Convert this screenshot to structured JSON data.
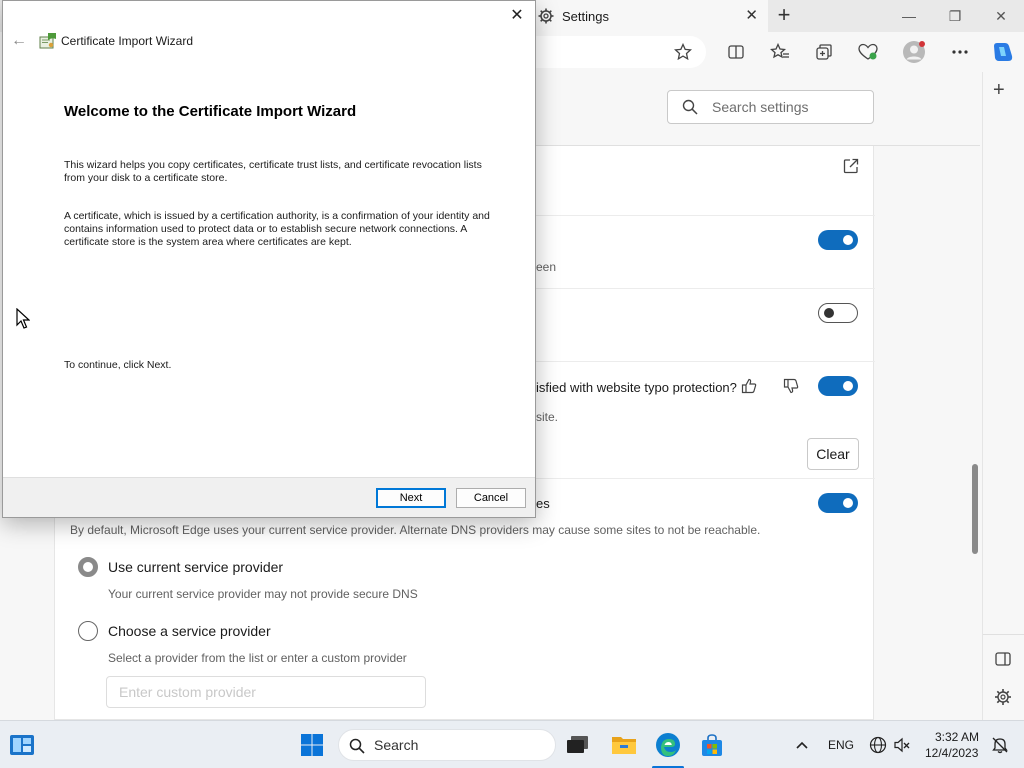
{
  "browser": {
    "tab_title": "Settings",
    "tab_close": "✕",
    "new_tab": "+",
    "window_controls": {
      "minimize": "—",
      "restore": "❐",
      "close": "✕"
    }
  },
  "settings": {
    "search_placeholder": "Search settings",
    "frag_screen": "een",
    "frag_typo_question": "isfied with website typo protection?",
    "frag_site": "site.",
    "clear_label": "Clear",
    "frag_es": "es",
    "dns_desc": "By default, Microsoft Edge uses your current service provider. Alternate DNS providers may cause some sites to not be reachable.",
    "option_current": "Use current service provider",
    "option_current_desc": "Your current service provider may not provide secure DNS",
    "option_choose": "Choose a service provider",
    "option_choose_desc": "Select a provider from the list or enter a custom provider",
    "provider_placeholder": "Enter custom provider",
    "toggles": {
      "first": true,
      "second": false,
      "third": true,
      "fourth": true
    },
    "dns_selected": "current"
  },
  "wizard": {
    "title": "Certificate Import Wizard",
    "close": "✕",
    "back": "←",
    "heading": "Welcome to the Certificate Import Wizard",
    "para1": "This wizard helps you copy certificates, certificate trust lists, and certificate revocation lists from your disk to a certificate store.",
    "para2": "A certificate, which is issued by a certification authority, is a confirmation of your identity and contains information used to protect data or to establish secure network connections. A certificate store is the system area where certificates are kept.",
    "continue_text": "To continue, click Next.",
    "next_label": "Next",
    "cancel_label": "Cancel"
  },
  "taskbar": {
    "search_label": "Search",
    "language": "ENG",
    "time": "3:32 AM",
    "date": "12/4/2023"
  },
  "icons": {
    "accent": "#0f6cbd",
    "wizard_primary": "#0078d7"
  }
}
